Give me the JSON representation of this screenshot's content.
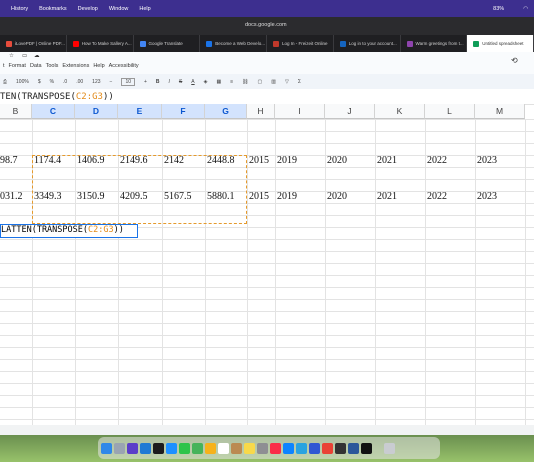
{
  "mac_menu": [
    "History",
    "Bookmarks",
    "Develop",
    "Window",
    "Help"
  ],
  "status": {
    "battery": "83%"
  },
  "url": "docs.google.com",
  "tabs": [
    {
      "label": "iLovePDF | Online PDF...",
      "color": "#e74c3c"
    },
    {
      "label": "How To Make Sallery A...",
      "color": "#ff0000"
    },
    {
      "label": "Google Translate",
      "color": "#4285f4"
    },
    {
      "label": "Become a Web Develo...",
      "color": "#1a73e8"
    },
    {
      "label": "Log In - Freizeit Online",
      "color": "#c0392b"
    },
    {
      "label": "Log in to your account...",
      "color": "#1565c0"
    },
    {
      "label": "Warm greetings from t...",
      "color": "#8e44ad"
    },
    {
      "label": "Untitled spreadsheet",
      "color": "#0f9d58"
    }
  ],
  "doc_menu": [
    "t",
    "Format",
    "Data",
    "Tools",
    "Extensions",
    "Help",
    "Accessibility"
  ],
  "toolbar": {
    "zoom": "100%",
    "currency": "$",
    "percent": "%",
    "dec1": ".0",
    "dec2": ".00",
    "num": "123",
    "font_size": "10"
  },
  "formula_bar": {
    "pre": "TEN(TRANSPOSE(",
    "ref": "C2:G3",
    "post": "))"
  },
  "columns": [
    "B",
    "C",
    "D",
    "E",
    "F",
    "G",
    "H",
    "I",
    "J",
    "K",
    "L",
    "M"
  ],
  "row1": [
    "98.7",
    "1174.4",
    "1406.9",
    "2149.6",
    "2142",
    "2448.8",
    "2015",
    "2019",
    "2020",
    "2021",
    "2022",
    "2023"
  ],
  "row2": [
    "031.2",
    "3349.3",
    "3150.9",
    "4209.5",
    "5167.5",
    "5880.1",
    "2015",
    "2019",
    "2020",
    "2021",
    "2022",
    "2023"
  ],
  "edit_cell": {
    "pre": "LATTEN(TRANSPOSE(",
    "ref": "C2:G3",
    "post": "))"
  }
}
